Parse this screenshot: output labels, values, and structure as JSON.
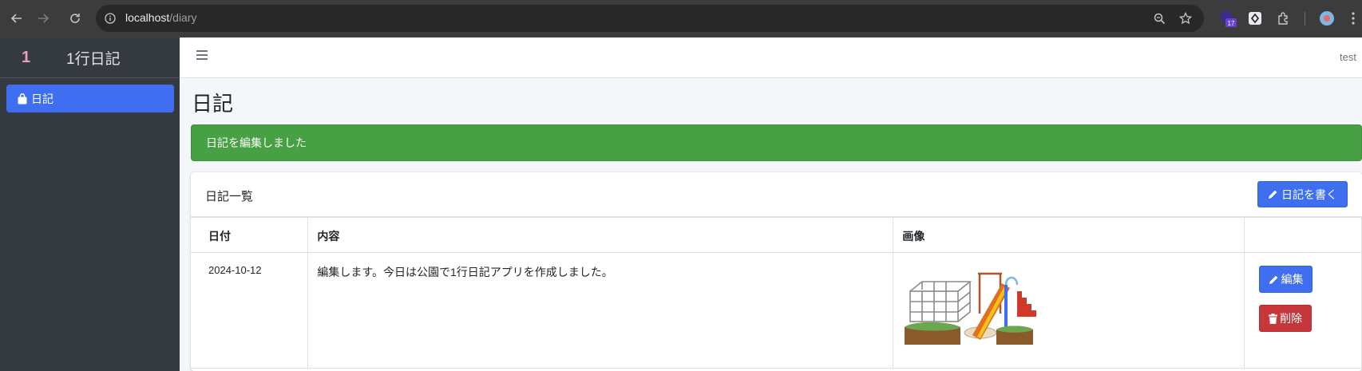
{
  "browser": {
    "url_host": "localhost",
    "url_path": "/diary",
    "extension_badge": "17"
  },
  "sidebar": {
    "logo": "1",
    "brand": "1行日記",
    "items": [
      {
        "label": "日記",
        "icon": "shopping-bag-icon",
        "active": true
      }
    ]
  },
  "topbar": {
    "user": "test"
  },
  "page": {
    "title": "日記"
  },
  "alert": {
    "message": "日記を編集しました",
    "color": "#47a044"
  },
  "card": {
    "title": "日記一覧",
    "write_button": "日記を書く",
    "columns": [
      "日付",
      "内容",
      "画像",
      ""
    ],
    "rows": [
      {
        "date": "2024-10-12",
        "content": "編集します。今日は公園で1行日記アプリを作成しました。",
        "image": "playground-illustration",
        "edit_label": "編集",
        "delete_label": "削除"
      }
    ]
  },
  "colors": {
    "primary": "#3f6ef0",
    "danger": "#c5373a",
    "success": "#47a044",
    "sidebar": "#343a40"
  }
}
